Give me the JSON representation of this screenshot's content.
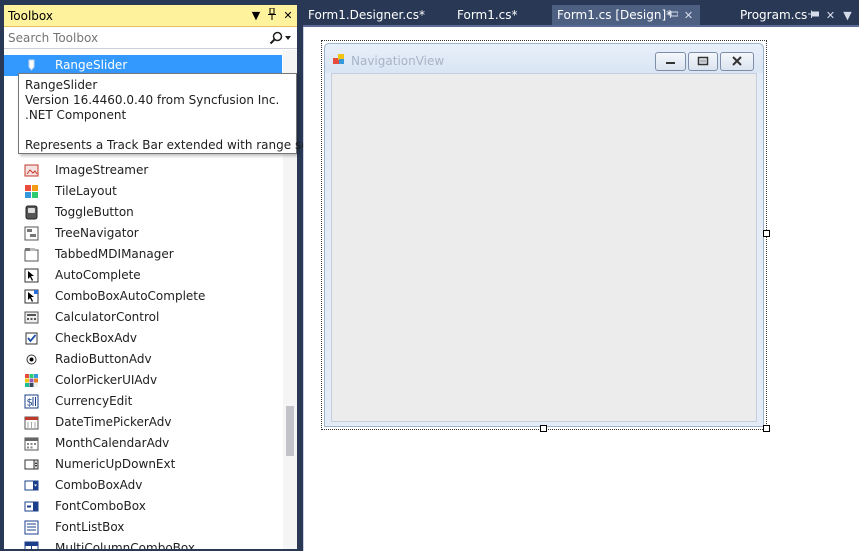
{
  "toolbox": {
    "title": "Toolbox",
    "pin_glyph": "▼",
    "dock_glyph": "⊥",
    "close_glyph": "✕",
    "search_placeholder": "Search Toolbox",
    "items": [
      {
        "label": "RangeSlider",
        "icon": "range-slider-icon",
        "selected": true
      },
      {
        "label": "ImageStreamer",
        "icon": "image-streamer-icon"
      },
      {
        "label": "TileLayout",
        "icon": "tile-layout-icon"
      },
      {
        "label": "ToggleButton",
        "icon": "toggle-button-icon"
      },
      {
        "label": "TreeNavigator",
        "icon": "tree-navigator-icon"
      },
      {
        "label": "TabbedMDIManager",
        "icon": "tabbed-mdi-icon"
      },
      {
        "label": "AutoComplete",
        "icon": "autocomplete-icon"
      },
      {
        "label": "ComboBoxAutoComplete",
        "icon": "combobox-autocomplete-icon"
      },
      {
        "label": "CalculatorControl",
        "icon": "calculator-icon"
      },
      {
        "label": "CheckBoxAdv",
        "icon": "checkbox-icon"
      },
      {
        "label": "RadioButtonAdv",
        "icon": "radio-button-icon"
      },
      {
        "label": "ColorPickerUIAdv",
        "icon": "color-picker-icon"
      },
      {
        "label": "CurrencyEdit",
        "icon": "currency-icon"
      },
      {
        "label": "DateTimePickerAdv",
        "icon": "datetime-picker-icon"
      },
      {
        "label": "MonthCalendarAdv",
        "icon": "month-calendar-icon"
      },
      {
        "label": "NumericUpDownExt",
        "icon": "numeric-updown-icon"
      },
      {
        "label": "ComboBoxAdv",
        "icon": "combobox-icon"
      },
      {
        "label": "FontComboBox",
        "icon": "font-combobox-icon"
      },
      {
        "label": "FontListBox",
        "icon": "font-listbox-icon"
      },
      {
        "label": "MultiColumnComboBox",
        "icon": "multicolumn-combobox-icon"
      }
    ],
    "tooltip": {
      "name": "RangeSlider",
      "version": "Version 16.4460.0.40 from Syncfusion Inc.",
      "kind": ".NET Component",
      "description": "Represents a Track Bar extended with range setting"
    }
  },
  "tabs": [
    {
      "label": "Form1.Designer.cs*",
      "active": false
    },
    {
      "label": "Form1.cs*",
      "active": false
    },
    {
      "label": "Form1.cs [Design]*",
      "active": true
    },
    {
      "label": "Program.cs",
      "active": false
    }
  ],
  "tab_buttons": {
    "pin": "⊥",
    "close": "✕",
    "overflow": "▼"
  },
  "designer": {
    "form_title": "NavigationView"
  },
  "colors": {
    "chrome": "#293955",
    "toolbox_title": "#fff29d",
    "selection": "#3399ff",
    "active_tab": "#4d6082"
  }
}
